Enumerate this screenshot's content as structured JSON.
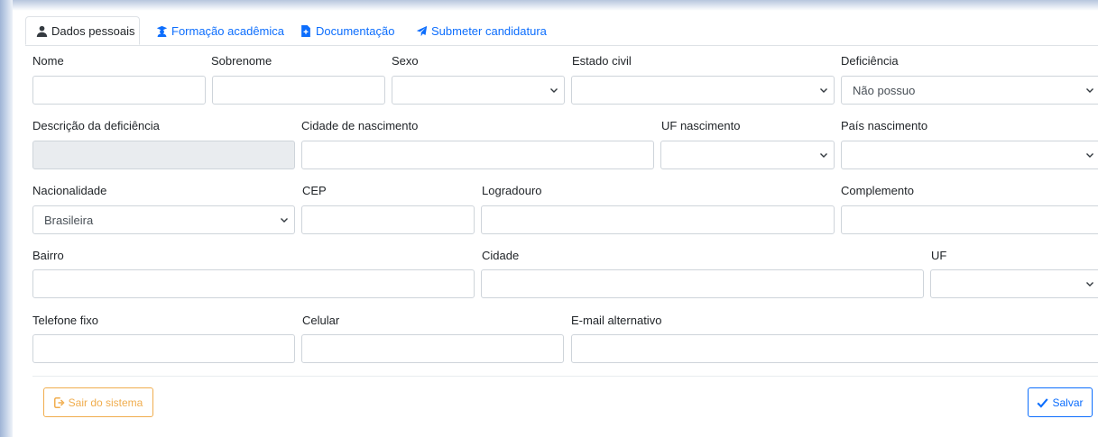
{
  "tabs": [
    {
      "label": "Dados pessoais",
      "icon": "user-icon"
    },
    {
      "label": "Formação acadêmica",
      "icon": "graduate-icon"
    },
    {
      "label": "Documentação",
      "icon": "document-icon"
    },
    {
      "label": "Submeter candidatura",
      "icon": "paper-plane-icon"
    }
  ],
  "form": {
    "nome": {
      "label": "Nome",
      "value": ""
    },
    "sobrenome": {
      "label": "Sobrenome",
      "value": ""
    },
    "sexo": {
      "label": "Sexo",
      "value": ""
    },
    "estado_civil": {
      "label": "Estado civil",
      "value": ""
    },
    "deficiencia": {
      "label": "Deficiência",
      "value": "Não possuo"
    },
    "descricao_deficiencia": {
      "label": "Descrição da deficiência",
      "value": ""
    },
    "cidade_nascimento": {
      "label": "Cidade de nascimento",
      "value": ""
    },
    "uf_nascimento": {
      "label": "UF nascimento",
      "value": ""
    },
    "pais_nascimento": {
      "label": "País nascimento",
      "value": ""
    },
    "nacionalidade": {
      "label": "Nacionalidade",
      "value": "Brasileira"
    },
    "cep": {
      "label": "CEP",
      "value": ""
    },
    "logradouro": {
      "label": "Logradouro",
      "value": ""
    },
    "complemento": {
      "label": "Complemento",
      "value": ""
    },
    "bairro": {
      "label": "Bairro",
      "value": ""
    },
    "cidade": {
      "label": "Cidade",
      "value": ""
    },
    "uf": {
      "label": "UF",
      "value": ""
    },
    "telefone_fixo": {
      "label": "Telefone fixo",
      "value": ""
    },
    "celular": {
      "label": "Celular",
      "value": ""
    },
    "email_alternativo": {
      "label": "E-mail alternativo",
      "value": ""
    }
  },
  "actions": {
    "sair_label": "Sair do sistema",
    "salvar_label": "Salvar"
  },
  "colors": {
    "primary": "#0d6efd",
    "warning": "#f0ad4e",
    "disabled_bg": "#e9ecef"
  }
}
